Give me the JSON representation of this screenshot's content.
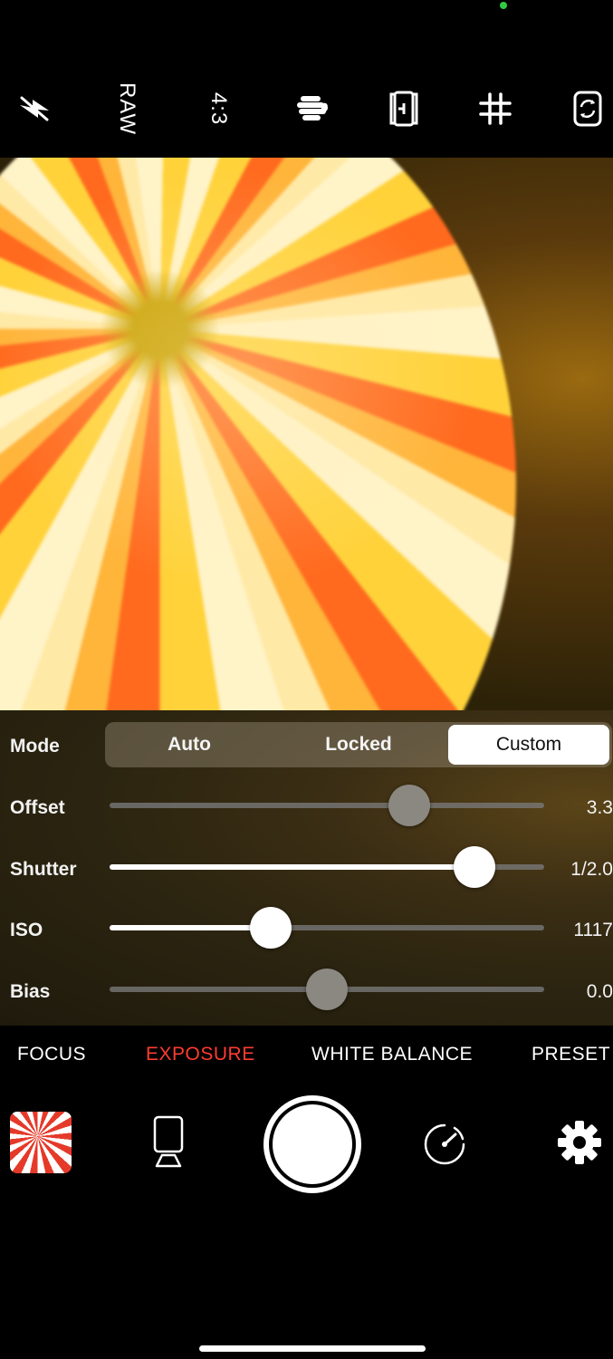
{
  "toolbar": {
    "flash_icon": "flash-off-icon",
    "raw_label": "RAW",
    "aspect_label": "4:3",
    "stabilizer_icon": "hand-icon",
    "focus_peaking_icon": "frame-icon",
    "grid_icon": "grid-icon",
    "flip_icon": "camera-flip-icon"
  },
  "exposure": {
    "mode_label": "Mode",
    "modes": [
      "Auto",
      "Locked",
      "Custom"
    ],
    "selected_mode": "Custom",
    "sliders": [
      {
        "label": "Offset",
        "value_text": "3.3",
        "position": 0.69,
        "filled": false
      },
      {
        "label": "Shutter",
        "value_text": "1/2.0",
        "position": 0.84,
        "filled": true
      },
      {
        "label": "ISO",
        "value_text": "1117",
        "position": 0.37,
        "filled": true
      },
      {
        "label": "Bias",
        "value_text": "0.0",
        "position": 0.5,
        "filled": false
      }
    ]
  },
  "tabs": {
    "items": [
      "FOCUS",
      "EXPOSURE",
      "WHITE BALANCE",
      "PRESET"
    ],
    "active": "EXPOSURE"
  },
  "bottom": {
    "gallery_icon": "gallery-thumbnail",
    "mode_icon": "tripod-icon",
    "shutter": "shutter-button",
    "timer_icon": "speedometer-icon",
    "settings_icon": "gear-icon"
  },
  "colors": {
    "active_tab": "#ff3b30",
    "status_dot": "#2ecc40"
  }
}
